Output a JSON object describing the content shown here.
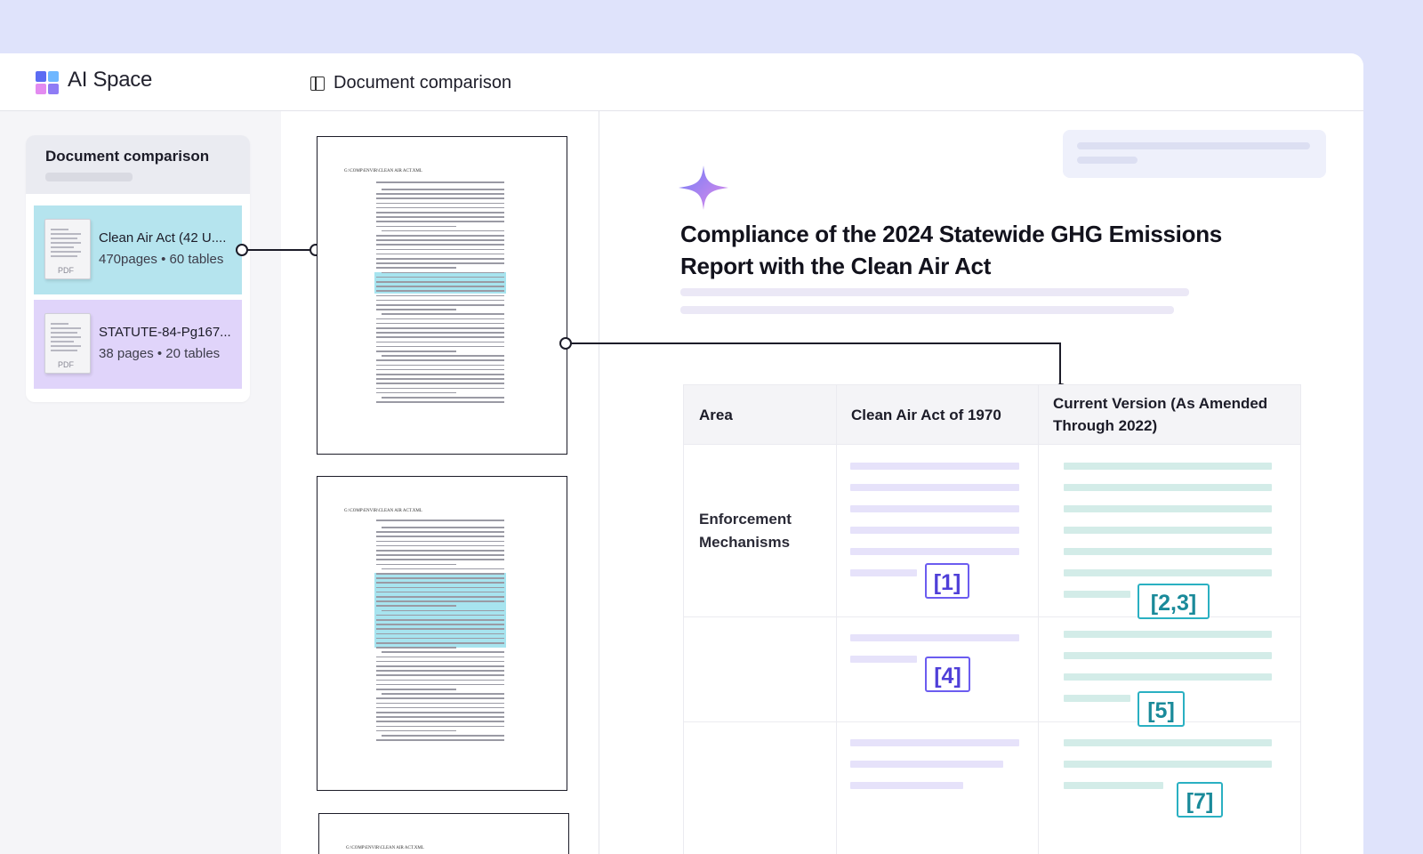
{
  "app": {
    "brand": "AI Space"
  },
  "header": {
    "title": "Document comparison"
  },
  "sidebar": {
    "card_title": "Document comparison",
    "files": [
      {
        "name": "Clean Air Act (42 U....",
        "meta": "470pages • 60 tables",
        "type": "PDF",
        "color": "#b5e4ee"
      },
      {
        "name": "STATUTE-84-Pg167...",
        "meta": "38 pages • 20 tables",
        "type": "PDF",
        "color": "#e0d4fa"
      }
    ]
  },
  "pages": [
    {
      "runhead": "G:\\COMP\\ENVIR\\CLEAN AIR ACT.XML"
    },
    {
      "runhead": "G:\\COMP\\ENVIR\\CLEAN AIR ACT.XML"
    },
    {
      "runhead": "G:\\COMP\\ENVIR\\CLEAN AIR ACT.XML"
    }
  ],
  "report": {
    "title": "Compliance of the 2024 Statewide GHG Emissions Report with the Clean Air Act"
  },
  "table": {
    "headers": [
      "Area",
      "Clean Air Act of 1970",
      "Current Version (As Amended Through 2022)"
    ],
    "rows": [
      {
        "area": "Enforcement Mechanisms"
      }
    ],
    "citations": [
      "[1]",
      "[2,3]",
      "[4]",
      "[5]",
      "[7]"
    ]
  },
  "colors": {
    "accent_purple": "#6b5cf0",
    "accent_teal": "#2ab0c2",
    "page_bg": "#dfe3fb"
  }
}
